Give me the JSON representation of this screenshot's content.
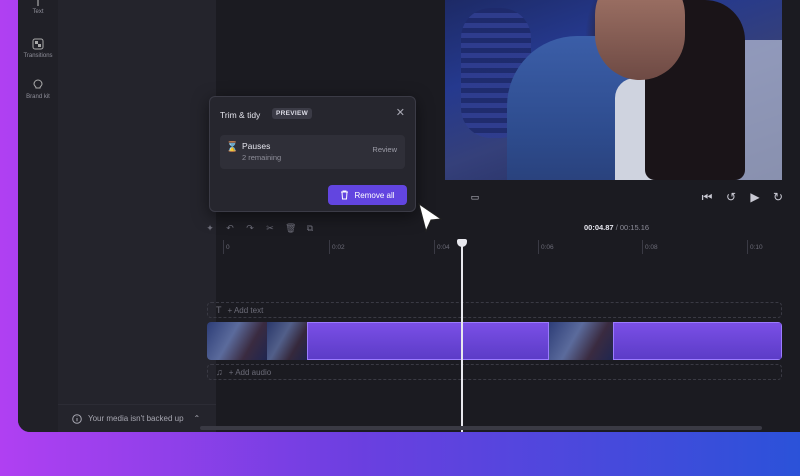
{
  "rail": {
    "items": [
      {
        "label": "Text",
        "icon": "text-icon"
      },
      {
        "label": "Transitions",
        "icon": "transitions-icon"
      },
      {
        "label": "Brand kit",
        "icon": "brand-kit-icon"
      }
    ]
  },
  "panel": {
    "backup_text": "Your media isn't backed up"
  },
  "popup": {
    "title": "Trim & tidy",
    "badge": "PREVIEW",
    "item_title": "Pauses",
    "item_sub": "2 remaining",
    "review_label": "Review",
    "remove_all_label": "Remove all"
  },
  "timeline": {
    "current_time": "00:04.87",
    "total_time": "/ 00:15.16",
    "ticks": [
      "0",
      "0:02",
      "0:04",
      "0:06",
      "0:08",
      "0:10"
    ],
    "add_text": "+ Add text",
    "add_audio": "+ Add audio"
  },
  "colors": {
    "accent": "#6245e0",
    "clip_highlight": "#7a4fe6"
  }
}
